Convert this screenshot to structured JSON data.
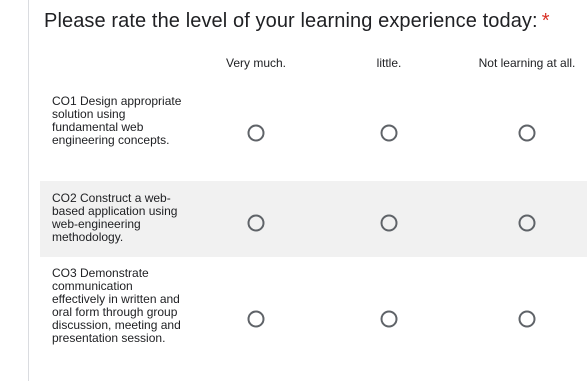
{
  "question": {
    "title": "Please rate the level of your learning experience today:",
    "required_mark": "*"
  },
  "columns": [
    {
      "label": "Very much."
    },
    {
      "label": "little."
    },
    {
      "label": "Not learning at all."
    }
  ],
  "rows": [
    {
      "label": "CO1 Design appropriate solution using fundamental web engineering concepts.",
      "shaded": false
    },
    {
      "label": "CO2 Construct a web-based application using web-engineering methodology.",
      "shaded": true
    },
    {
      "label": "CO3 Demonstrate communication effectively in written and oral form through group discussion, meeting and presentation session.",
      "shaded": false
    }
  ],
  "colors": {
    "required": "#d93025",
    "text": "#202124",
    "radio_border": "#5f6368",
    "row_shade": "#f1f1f1"
  }
}
